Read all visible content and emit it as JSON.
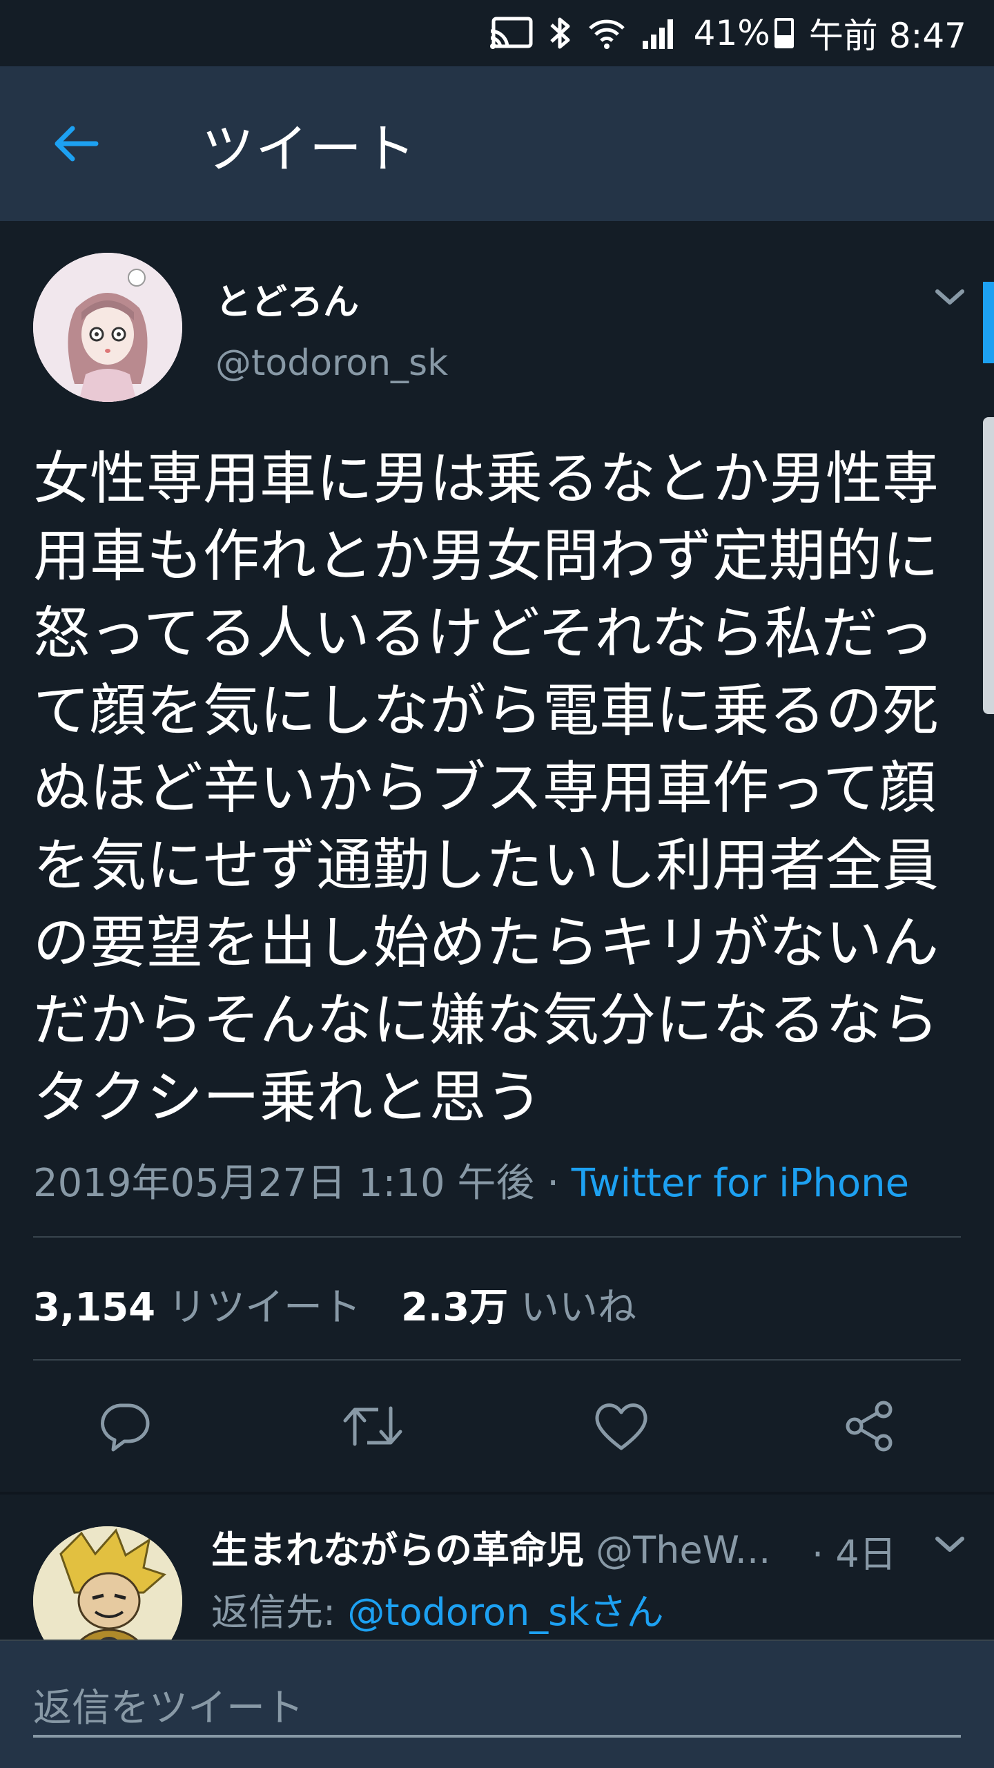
{
  "status_bar": {
    "battery": "41%",
    "battery_level": 0.41,
    "time": "午前 8:47",
    "icons": [
      "cast-icon",
      "bluetooth-icon",
      "wifi-icon",
      "signal-icon",
      "battery-icon"
    ]
  },
  "header": {
    "back_icon": "arrow-left-icon",
    "title": "ツイート"
  },
  "tweet": {
    "display_name": "とどろん",
    "handle": "@todoron_sk",
    "text": "女性専用車に男は乗るなとか男性専用車も作れとか男女問わず定期的に怒ってる人いるけどそれなら私だって顔を気にしながら電車に乗るの死ぬほど辛いからブス専用車作って顔を気にせず通勤したいし利用者全員の要望を出し始めたらキリがないんだからそんなに嫌な気分になるならタクシー乗れと思う",
    "timestamp": "2019年05月27日 1:10 午後",
    "separator": " · ",
    "source": "Twitter for iPhone",
    "retweet_count": "3,154",
    "retweet_label": "リツイート",
    "like_count": "2.3万",
    "like_label": "いいね",
    "actions": [
      "reply-icon",
      "retweet-icon",
      "like-icon",
      "share-icon"
    ]
  },
  "reply_preview": {
    "display_name": "生まれながらの革命児",
    "handle": "@TheW...",
    "time": "· 4日",
    "reply_to_label": "返信先: ",
    "reply_to_mention": "@todoron_skさん"
  },
  "compose": {
    "placeholder": "返信をツイート"
  },
  "colors": {
    "background": "#141d26",
    "header": "#243447",
    "accent": "#1da1f2",
    "secondary_text": "#8899a6",
    "divider": "#38444d"
  }
}
